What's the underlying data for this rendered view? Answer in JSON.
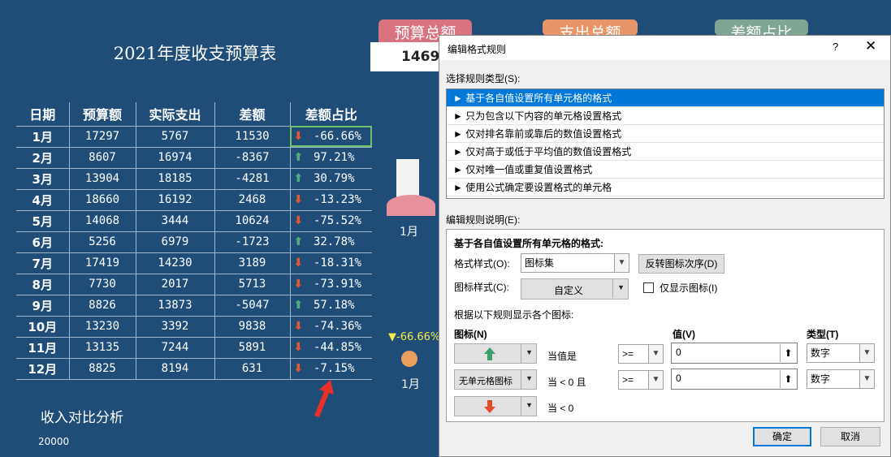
{
  "sheet": {
    "title": "2021年度收支预算表",
    "kpi": {
      "budget_label": "预算总额",
      "expense_label": "支出总额",
      "diff_label": "差额占比",
      "budget_value": "1469"
    },
    "columns": [
      "日期",
      "预算额",
      "实际支出",
      "差额",
      "差额占比"
    ],
    "rows": [
      {
        "m": "1月",
        "budget": "17297",
        "actual": "5767",
        "diff": "11530",
        "arrow": "down",
        "pct": "-66.66%"
      },
      {
        "m": "2月",
        "budget": "8607",
        "actual": "16974",
        "diff": "-8367",
        "arrow": "up",
        "pct": "97.21%"
      },
      {
        "m": "3月",
        "budget": "13904",
        "actual": "18185",
        "diff": "-4281",
        "arrow": "up",
        "pct": "30.79%"
      },
      {
        "m": "4月",
        "budget": "18660",
        "actual": "16192",
        "diff": "2468",
        "arrow": "down",
        "pct": "-13.23%"
      },
      {
        "m": "5月",
        "budget": "14068",
        "actual": "3444",
        "diff": "10624",
        "arrow": "down",
        "pct": "-75.52%"
      },
      {
        "m": "6月",
        "budget": "5256",
        "actual": "6979",
        "diff": "-1723",
        "arrow": "up",
        "pct": "32.78%"
      },
      {
        "m": "7月",
        "budget": "17419",
        "actual": "14230",
        "diff": "3189",
        "arrow": "down",
        "pct": "-18.31%"
      },
      {
        "m": "8月",
        "budget": "7730",
        "actual": "2017",
        "diff": "5713",
        "arrow": "down",
        "pct": "-73.91%"
      },
      {
        "m": "9月",
        "budget": "8826",
        "actual": "13873",
        "diff": "-5047",
        "arrow": "up",
        "pct": "57.18%"
      },
      {
        "m": "10月",
        "budget": "13230",
        "actual": "3392",
        "diff": "9838",
        "arrow": "down",
        "pct": "-74.36%"
      },
      {
        "m": "11月",
        "budget": "13135",
        "actual": "7244",
        "diff": "5891",
        "arrow": "down",
        "pct": "-44.85%"
      },
      {
        "m": "12月",
        "budget": "8825",
        "actual": "8194",
        "diff": "631",
        "arrow": "down",
        "pct": "-7.15%"
      }
    ],
    "chart_month_label": "1月",
    "chart2_marker": "▼-66.66%",
    "chart2_month_label": "1月",
    "section_title": "收入对比分析",
    "axis_value": "20000",
    "colors": {
      "background": "#1f4d78",
      "up": "#4fae7b",
      "down": "#e9552f"
    }
  },
  "dialog": {
    "title": "编辑格式规则",
    "help": "?",
    "close": "✕",
    "select_type_label": "选择规则类型(S):",
    "rule_types": [
      "► 基于各自值设置所有单元格的格式",
      "► 只为包含以下内容的单元格设置格式",
      "► 仅对排名靠前或靠后的数值设置格式",
      "► 仅对高于或低于平均值的数值设置格式",
      "► 仅对唯一值或重复值设置格式",
      "► 使用公式确定要设置格式的单元格"
    ],
    "edit_desc_label": "编辑规则说明(E):",
    "desc_heading": "基于各自值设置所有单元格的格式:",
    "format_style_label": "格式样式(O):",
    "format_style_value": "图标集",
    "reverse_button": "反转图标次序(D)",
    "icon_style_label": "图标样式(C):",
    "icon_style_value": "自定义",
    "show_icon_only": "仅显示图标(I)",
    "show_icon_only_checked": false,
    "rule_hint": "根据以下规则显示各个图标:",
    "col_icon": "图标(N)",
    "col_value": "值(V)",
    "col_type": "类型(T)",
    "icon_rules": [
      {
        "icon": "up-arrow",
        "cond": "当值是",
        "op": ">=",
        "value": "0",
        "type": "数字"
      },
      {
        "icon_text": "无单元格图标",
        "cond": "当 < 0 且",
        "op": ">=",
        "value": "0",
        "type": "数字"
      },
      {
        "icon": "down-arrow",
        "cond": "当 < 0"
      }
    ],
    "ok": "确定",
    "cancel": "取消"
  }
}
